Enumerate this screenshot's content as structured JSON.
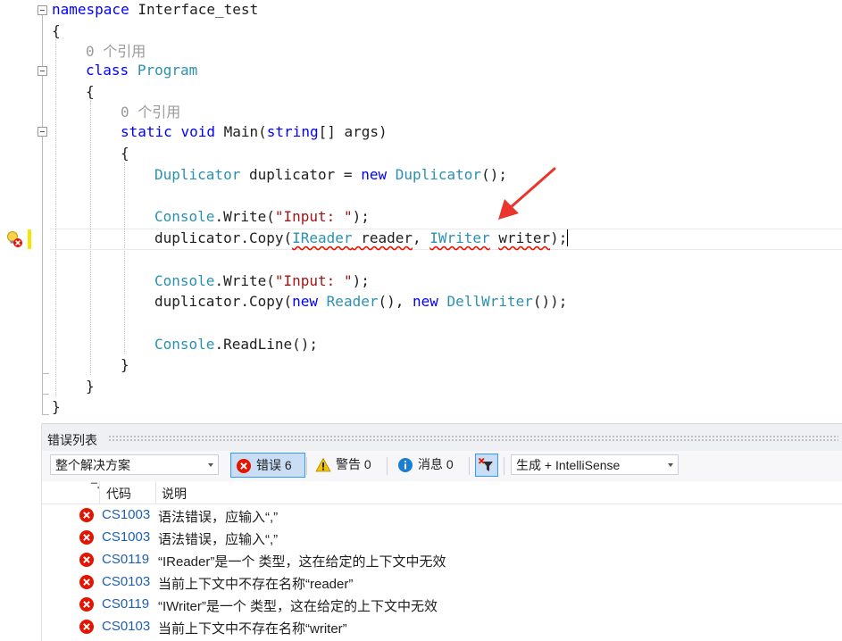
{
  "editor": {
    "lines": {
      "l1": {
        "kw": "namespace",
        "rest": " Interface_test"
      },
      "l2": "{",
      "l3_refs": "0 个引用",
      "l4": {
        "kw": "class",
        "type": "Program"
      },
      "l5": "{",
      "l6_refs": "0 个引用",
      "l7": {
        "kw1": "static",
        "kw2": "void",
        "name": "Main(",
        "kw3": "string",
        "rest": "[] args)"
      },
      "l8": "{",
      "l9": {
        "type1": "Duplicator",
        "mid": " duplicator = ",
        "kw": "new",
        "type2": "Duplicator",
        "end": "();"
      },
      "l10": {
        "type": "Console",
        "method": ".Write(",
        "str": "\"Input: \"",
        "end": ");"
      },
      "l11": {
        "start": "duplicator.Copy(",
        "type1": "IReader",
        "p1": " reader",
        "comma1": ", ",
        "type2": "IWriter",
        "sp": " ",
        "p2": "writer",
        "end": ");"
      },
      "l12": {
        "type": "Console",
        "method": ".Write(",
        "str": "\"Input: \"",
        "end": ");"
      },
      "l13": {
        "start": "duplicator.Copy(",
        "kw1": "new",
        "type1": "Reader",
        "mid": "(), ",
        "kw2": "new",
        "type2": "DellWriter",
        "end": "());"
      },
      "l14": {
        "type": "Console",
        "method": ".ReadLine",
        "end": "();"
      },
      "l15": "}",
      "l16": "}",
      "l17": "}"
    }
  },
  "error_list": {
    "title": "错误列表",
    "scope": "整个解决方案",
    "errors_label": "错误 6",
    "warnings_label": "警告 0",
    "messages_label": "消息 0",
    "build_filter": "生成 + IntelliSense",
    "columns": {
      "code": "代码",
      "description": "说明"
    },
    "rows": [
      {
        "code": "CS1003",
        "desc": "语法错误，应输入“,”"
      },
      {
        "code": "CS1003",
        "desc": "语法错误，应输入“,”"
      },
      {
        "code": "CS0119",
        "desc": "“IReader”是一个 类型，这在给定的上下文中无效"
      },
      {
        "code": "CS0103",
        "desc": "当前上下文中不存在名称“reader”"
      },
      {
        "code": "CS0119",
        "desc": "“IWriter”是一个 类型，这在给定的上下文中无效"
      },
      {
        "code": "CS0103",
        "desc": "当前上下文中不存在名称“writer”"
      }
    ]
  },
  "icons": {
    "fold": "collapse-box-icon",
    "lightbulb": "lightbulb-error-icon",
    "error": "error-circle-icon",
    "warning": "warning-triangle-icon",
    "info": "info-circle-icon",
    "filter": "filter-icon"
  },
  "colors": {
    "keyword": "#0000ff",
    "type": "#2b91af",
    "string": "#a31515",
    "error": "#e51400",
    "code_link": "#1f5fae",
    "annotation_arrow": "#e8362c"
  }
}
